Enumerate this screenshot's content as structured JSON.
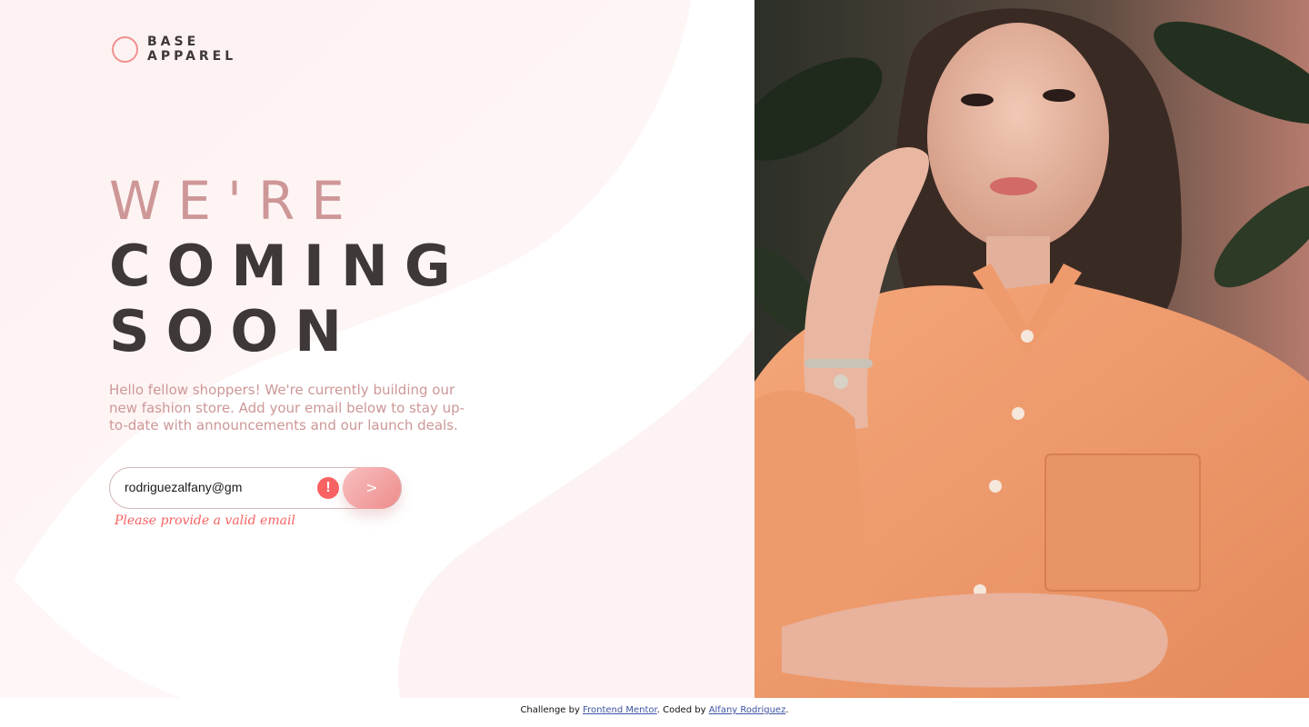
{
  "brand": {
    "line1": "BASE",
    "line2": "APPAREL"
  },
  "headline": {
    "light": "WE'RE",
    "dark1": "COMING",
    "dark2": "SOON"
  },
  "description": "Hello fellow shoppers! We're currently building our new fashion store. Add your email below to stay up-to-date with announcements and our launch deals.",
  "form": {
    "email_value": "rodriguezalfany@gm",
    "error_icon_glyph": "!",
    "submit_label": ">",
    "error_message": "Please provide a valid email"
  },
  "footer": {
    "prefix": "Challenge by ",
    "link1": "Frontend Mentor",
    "middle": ". Coded by ",
    "link2": "Alfany Rodriguez",
    "suffix": "."
  },
  "colors": {
    "accent": "#f0908f",
    "desaturated_red": "#ce9797",
    "dark_grayish_red": "#3e3838",
    "error": "#f96262"
  },
  "icons": {
    "logo": "ring-logo-icon",
    "error": "exclamation-icon",
    "submit": "chevron-right-icon"
  }
}
